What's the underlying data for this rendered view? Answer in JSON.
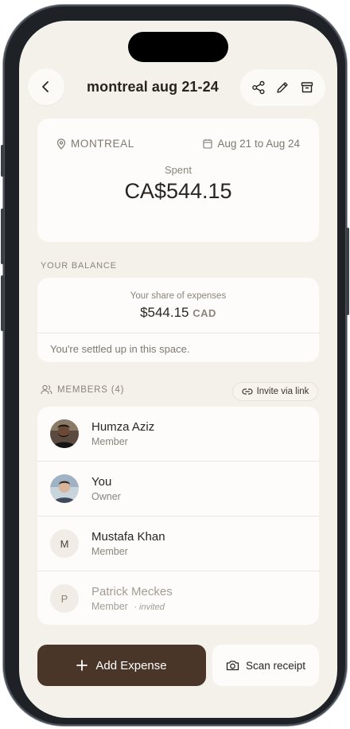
{
  "header": {
    "title": "montreal aug 21-24"
  },
  "summary": {
    "location": "MONTREAL",
    "date_range": "Aug 21 to Aug 24",
    "spent_label": "Spent",
    "spent_amount": "CA$544.15"
  },
  "balance": {
    "section_label": "YOUR BALANCE",
    "share_label": "Your share of expenses",
    "share_amount": "$544.15",
    "share_currency": "CAD",
    "status": "You're settled up in this space."
  },
  "members": {
    "section_label": "MEMBERS (4)",
    "invite_label": "Invite via link",
    "items": [
      {
        "name": "Humza Aziz",
        "role": "Member",
        "avatar": "photo"
      },
      {
        "name": "You",
        "role": "Owner",
        "avatar": "photo"
      },
      {
        "name": "Mustafa Khan",
        "role": "Member",
        "avatar": "M"
      },
      {
        "name": "Patrick Meckes",
        "role": "Member",
        "avatar": "P",
        "tag": "· invited"
      }
    ]
  },
  "footer": {
    "add_expense_label": "Add Expense",
    "scan_receipt_label": "Scan receipt"
  },
  "colors": {
    "background": "#f4f1ea",
    "card": "#fdfcfa",
    "primary_button": "#4a3629",
    "muted_text": "#8b847c"
  },
  "icons": [
    "back-chevron-icon",
    "share-icon",
    "edit-pencil-icon",
    "archive-box-icon",
    "location-pin-icon",
    "calendar-icon",
    "people-icon",
    "link-icon",
    "plus-icon",
    "camera-icon"
  ]
}
